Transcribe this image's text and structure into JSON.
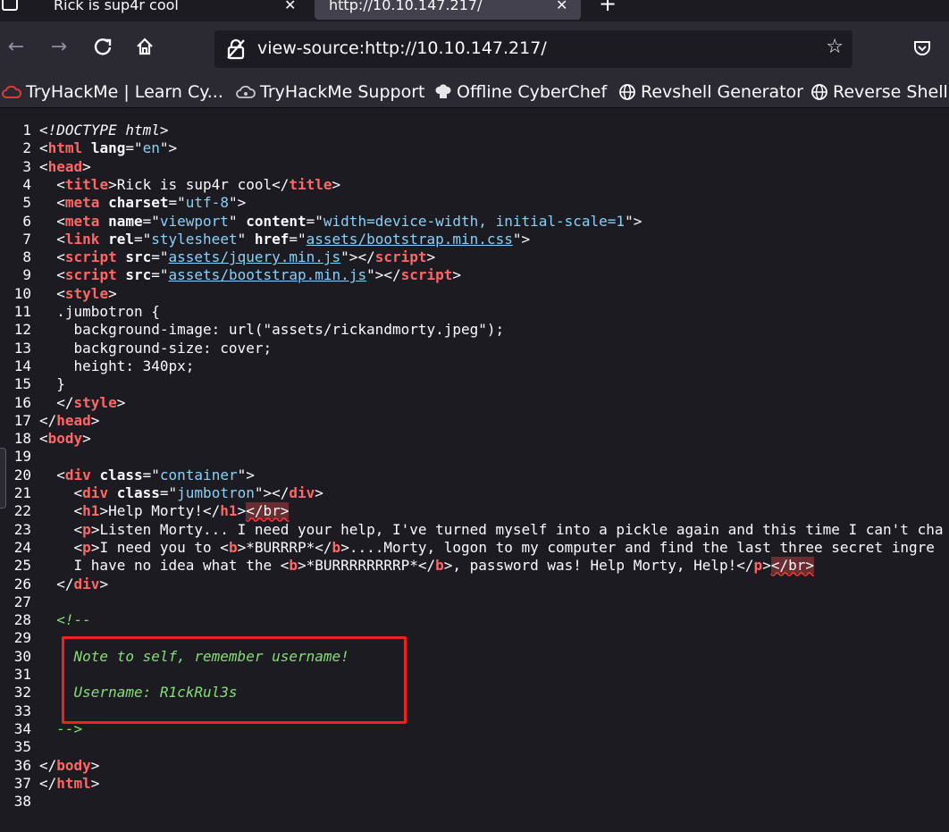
{
  "tabs": [
    {
      "label": "Rick is sup4r cool",
      "active": false
    },
    {
      "label": "http://10.10.147.217/",
      "active": true
    }
  ],
  "toolbar": {
    "url": "view-source:http://10.10.147.217/"
  },
  "bookmarks": [
    {
      "label": "TryHackMe | Learn Cy...",
      "icon": "tryhackme-cloud-icon"
    },
    {
      "label": "TryHackMe Support",
      "icon": "support-cloud-icon"
    },
    {
      "label": "Offline CyberChef",
      "icon": "chef-hat-icon"
    },
    {
      "label": "Revshell Generator",
      "icon": "globe-icon"
    },
    {
      "label": "Reverse Shell C",
      "icon": "globe-icon"
    }
  ],
  "source": {
    "lines": [
      [
        {
          "c": "dt",
          "t": "<!DOCTYPE html>"
        }
      ],
      [
        {
          "t": "<"
        },
        {
          "c": "tg",
          "t": "html"
        },
        {
          "t": " "
        },
        {
          "c": "at",
          "t": "lang"
        },
        {
          "t": "=\""
        },
        {
          "c": "av",
          "t": "en"
        },
        {
          "t": "\">"
        }
      ],
      [
        {
          "t": "<"
        },
        {
          "c": "tg",
          "t": "head"
        },
        {
          "t": ">"
        }
      ],
      [
        {
          "t": "  <"
        },
        {
          "c": "tg",
          "t": "title"
        },
        {
          "t": ">Rick is sup4r cool</"
        },
        {
          "c": "tg",
          "t": "title"
        },
        {
          "t": ">"
        }
      ],
      [
        {
          "t": "  <"
        },
        {
          "c": "tg",
          "t": "meta"
        },
        {
          "t": " "
        },
        {
          "c": "at",
          "t": "charset"
        },
        {
          "t": "=\""
        },
        {
          "c": "av",
          "t": "utf-8"
        },
        {
          "t": "\">"
        }
      ],
      [
        {
          "t": "  <"
        },
        {
          "c": "tg",
          "t": "meta"
        },
        {
          "t": " "
        },
        {
          "c": "at",
          "t": "name"
        },
        {
          "t": "=\""
        },
        {
          "c": "av",
          "t": "viewport"
        },
        {
          "t": "\" "
        },
        {
          "c": "at",
          "t": "content"
        },
        {
          "t": "=\""
        },
        {
          "c": "av",
          "t": "width=device-width, initial-scale=1"
        },
        {
          "t": "\">"
        }
      ],
      [
        {
          "t": "  <"
        },
        {
          "c": "tg",
          "t": "link"
        },
        {
          "t": " "
        },
        {
          "c": "at",
          "t": "rel"
        },
        {
          "t": "=\""
        },
        {
          "c": "av",
          "t": "stylesheet"
        },
        {
          "t": "\" "
        },
        {
          "c": "at",
          "t": "href"
        },
        {
          "t": "=\""
        },
        {
          "c": "lk",
          "t": "assets/bootstrap.min.css"
        },
        {
          "t": "\">"
        }
      ],
      [
        {
          "t": "  <"
        },
        {
          "c": "tg",
          "t": "script"
        },
        {
          "t": " "
        },
        {
          "c": "at",
          "t": "src"
        },
        {
          "t": "=\""
        },
        {
          "c": "lk",
          "t": "assets/jquery.min.js"
        },
        {
          "t": "\"></"
        },
        {
          "c": "tg",
          "t": "script"
        },
        {
          "t": ">"
        }
      ],
      [
        {
          "t": "  <"
        },
        {
          "c": "tg",
          "t": "script"
        },
        {
          "t": " "
        },
        {
          "c": "at",
          "t": "src"
        },
        {
          "t": "=\""
        },
        {
          "c": "lk",
          "t": "assets/bootstrap.min.js"
        },
        {
          "t": "\"></"
        },
        {
          "c": "tg",
          "t": "script"
        },
        {
          "t": ">"
        }
      ],
      [
        {
          "t": "  <"
        },
        {
          "c": "tg",
          "t": "style"
        },
        {
          "t": ">"
        }
      ],
      [
        {
          "t": "  .jumbotron {"
        }
      ],
      [
        {
          "t": "    background-image: url(\"assets/rickandmorty.jpeg\");"
        }
      ],
      [
        {
          "t": "    background-size: cover;"
        }
      ],
      [
        {
          "t": "    height: 340px;"
        }
      ],
      [
        {
          "t": "  }"
        }
      ],
      [
        {
          "t": "  </"
        },
        {
          "c": "tg",
          "t": "style"
        },
        {
          "t": ">"
        }
      ],
      [
        {
          "t": "</"
        },
        {
          "c": "tg",
          "t": "head"
        },
        {
          "t": ">"
        }
      ],
      [
        {
          "t": "<"
        },
        {
          "c": "tg",
          "t": "body"
        },
        {
          "t": ">"
        }
      ],
      [
        {
          "t": ""
        }
      ],
      [
        {
          "t": "  <"
        },
        {
          "c": "tg",
          "t": "div"
        },
        {
          "t": " "
        },
        {
          "c": "at",
          "t": "class"
        },
        {
          "t": "=\""
        },
        {
          "c": "av",
          "t": "container"
        },
        {
          "t": "\">"
        }
      ],
      [
        {
          "t": "    <"
        },
        {
          "c": "tg",
          "t": "div"
        },
        {
          "t": " "
        },
        {
          "c": "at",
          "t": "class"
        },
        {
          "t": "=\""
        },
        {
          "c": "av",
          "t": "jumbotron"
        },
        {
          "t": "\"></"
        },
        {
          "c": "tg",
          "t": "div"
        },
        {
          "t": ">"
        }
      ],
      [
        {
          "t": "    <"
        },
        {
          "c": "tg",
          "t": "h1"
        },
        {
          "t": ">Help Morty!</"
        },
        {
          "c": "tg",
          "t": "h1"
        },
        {
          "t": ">"
        },
        {
          "c": "err",
          "t": "</br>"
        }
      ],
      [
        {
          "t": "    <"
        },
        {
          "c": "tg",
          "t": "p"
        },
        {
          "t": ">Listen Morty... I need your help, I've turned myself into a pickle again and this time I can't cha"
        }
      ],
      [
        {
          "t": "    <"
        },
        {
          "c": "tg",
          "t": "p"
        },
        {
          "t": ">I need you to <"
        },
        {
          "c": "tg",
          "t": "b"
        },
        {
          "t": ">*BURRRP*</"
        },
        {
          "c": "tg",
          "t": "b"
        },
        {
          "t": ">....Morty, logon to my computer and find the last three secret ingre"
        }
      ],
      [
        {
          "t": "    I have no idea what the <"
        },
        {
          "c": "tg",
          "t": "b"
        },
        {
          "t": ">*BURRRRRRRRP*</"
        },
        {
          "c": "tg",
          "t": "b"
        },
        {
          "t": ">, password was! Help Morty, Help!</"
        },
        {
          "c": "tg",
          "t": "p"
        },
        {
          "t": ">"
        },
        {
          "c": "err",
          "t": "</br>"
        }
      ],
      [
        {
          "t": "  </"
        },
        {
          "c": "tg",
          "t": "div"
        },
        {
          "t": ">"
        }
      ],
      [
        {
          "t": ""
        }
      ],
      [
        {
          "c": "cm",
          "t": "  <!--"
        }
      ],
      [
        {
          "t": ""
        }
      ],
      [
        {
          "c": "cm",
          "t": "    Note to self, remember username!"
        }
      ],
      [
        {
          "t": ""
        }
      ],
      [
        {
          "c": "cm",
          "t": "    Username: R1ckRul3s"
        }
      ],
      [
        {
          "t": ""
        }
      ],
      [
        {
          "c": "cm",
          "t": "  -->"
        }
      ],
      [
        {
          "t": ""
        }
      ],
      [
        {
          "t": "</"
        },
        {
          "c": "tg",
          "t": "body"
        },
        {
          "t": ">"
        }
      ],
      [
        {
          "t": "</"
        },
        {
          "c": "tg",
          "t": "html"
        },
        {
          "t": ">"
        }
      ],
      [
        {
          "t": ""
        }
      ]
    ]
  },
  "colors": {
    "tag": "#ff6666",
    "attr_value": "#8bd0f6",
    "comment": "#86de74",
    "highlight_box": "#ee2222"
  }
}
